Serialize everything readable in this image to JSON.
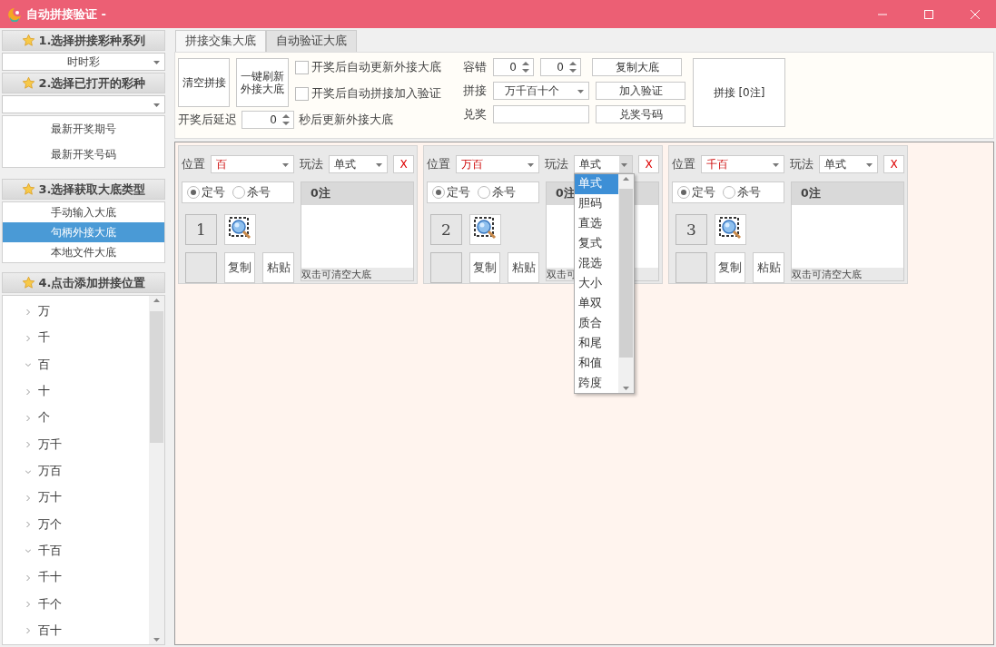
{
  "window": {
    "title": "自动拼接验证 -"
  },
  "sidebar": {
    "sections": [
      {
        "kind": "select",
        "title": "1.选择拼接彩种系列",
        "value": "时时彩"
      },
      {
        "kind": "select-info",
        "title": "2.选择已打开的彩种",
        "items": [
          "最新开奖期号",
          "最新开奖号码"
        ]
      },
      {
        "kind": "options",
        "title": "3.选择获取大底类型",
        "options": [
          {
            "label": "手动输入大底",
            "selected": false
          },
          {
            "label": "句柄外接大底",
            "selected": true
          },
          {
            "label": "本地文件大底",
            "selected": false
          }
        ]
      },
      {
        "kind": "tree",
        "title": "4.点击添加拼接位置",
        "items": [
          {
            "label": "万",
            "expanded": false
          },
          {
            "label": "千",
            "expanded": false
          },
          {
            "label": "百",
            "expanded": true
          },
          {
            "label": "十",
            "expanded": false
          },
          {
            "label": "个",
            "expanded": false
          },
          {
            "label": "万千",
            "expanded": false
          },
          {
            "label": "万百",
            "expanded": true
          },
          {
            "label": "万十",
            "expanded": false
          },
          {
            "label": "万个",
            "expanded": false
          },
          {
            "label": "千百",
            "expanded": true
          },
          {
            "label": "千十",
            "expanded": false
          },
          {
            "label": "千个",
            "expanded": false
          },
          {
            "label": "百十",
            "expanded": false
          }
        ]
      }
    ]
  },
  "tabs": [
    {
      "label": "拼接交集大底",
      "selected": true
    },
    {
      "label": "自动验证大底",
      "selected": false
    }
  ],
  "toolbar": {
    "clear_button": "清空拼接",
    "refresh_button": "一键刷新外接大底",
    "checkboxes": [
      {
        "label": "开奖后自动更新外接大底",
        "checked": false
      },
      {
        "label": "开奖后自动拼接加入验证",
        "checked": false
      }
    ],
    "delay": {
      "label": "开奖后延迟",
      "value": "0",
      "suffix": "秒后更新外接大底"
    },
    "tolerance": {
      "label": "容错",
      "values": [
        "0",
        "0"
      ],
      "button": "复制大底"
    },
    "splice": {
      "label": "拼接",
      "value": "万千百十个",
      "button": "加入验证"
    },
    "prize": {
      "label": "兑奖",
      "button": "兑奖号码"
    },
    "run_button": "拼接 [0注]"
  },
  "panels": [
    {
      "position_label": "位置",
      "position": "百",
      "play_label": "玩法",
      "play": "单式",
      "remove": "X",
      "modes": [
        {
          "label": "定号",
          "selected": true
        },
        {
          "label": "杀号",
          "selected": false
        }
      ],
      "number": "1",
      "count": "0注",
      "copy": "复制",
      "paste": "粘贴",
      "hint": "双击可清空大底"
    },
    {
      "position_label": "位置",
      "position": "万百",
      "play_label": "玩法",
      "play": "单式",
      "remove": "X",
      "modes": [
        {
          "label": "定号",
          "selected": true
        },
        {
          "label": "杀号",
          "selected": false
        }
      ],
      "number": "2",
      "count": "0注",
      "copy": "复制",
      "paste": "粘贴",
      "hint": "双击可",
      "dropdown": [
        {
          "label": "单式",
          "selected": true
        },
        {
          "label": "胆码",
          "selected": false
        },
        {
          "label": "直选",
          "selected": false
        },
        {
          "label": "复式",
          "selected": false
        },
        {
          "label": "混选",
          "selected": false
        },
        {
          "label": "大小",
          "selected": false
        },
        {
          "label": "单双",
          "selected": false
        },
        {
          "label": "质合",
          "selected": false
        },
        {
          "label": "和尾",
          "selected": false
        },
        {
          "label": "和值",
          "selected": false
        },
        {
          "label": "跨度",
          "selected": false
        }
      ]
    },
    {
      "position_label": "位置",
      "position": "千百",
      "play_label": "玩法",
      "play": "单式",
      "remove": "X",
      "modes": [
        {
          "label": "定号",
          "selected": true
        },
        {
          "label": "杀号",
          "selected": false
        }
      ],
      "number": "3",
      "count": "0注",
      "copy": "复制",
      "paste": "粘贴",
      "hint": "双击可清空大底"
    }
  ]
}
